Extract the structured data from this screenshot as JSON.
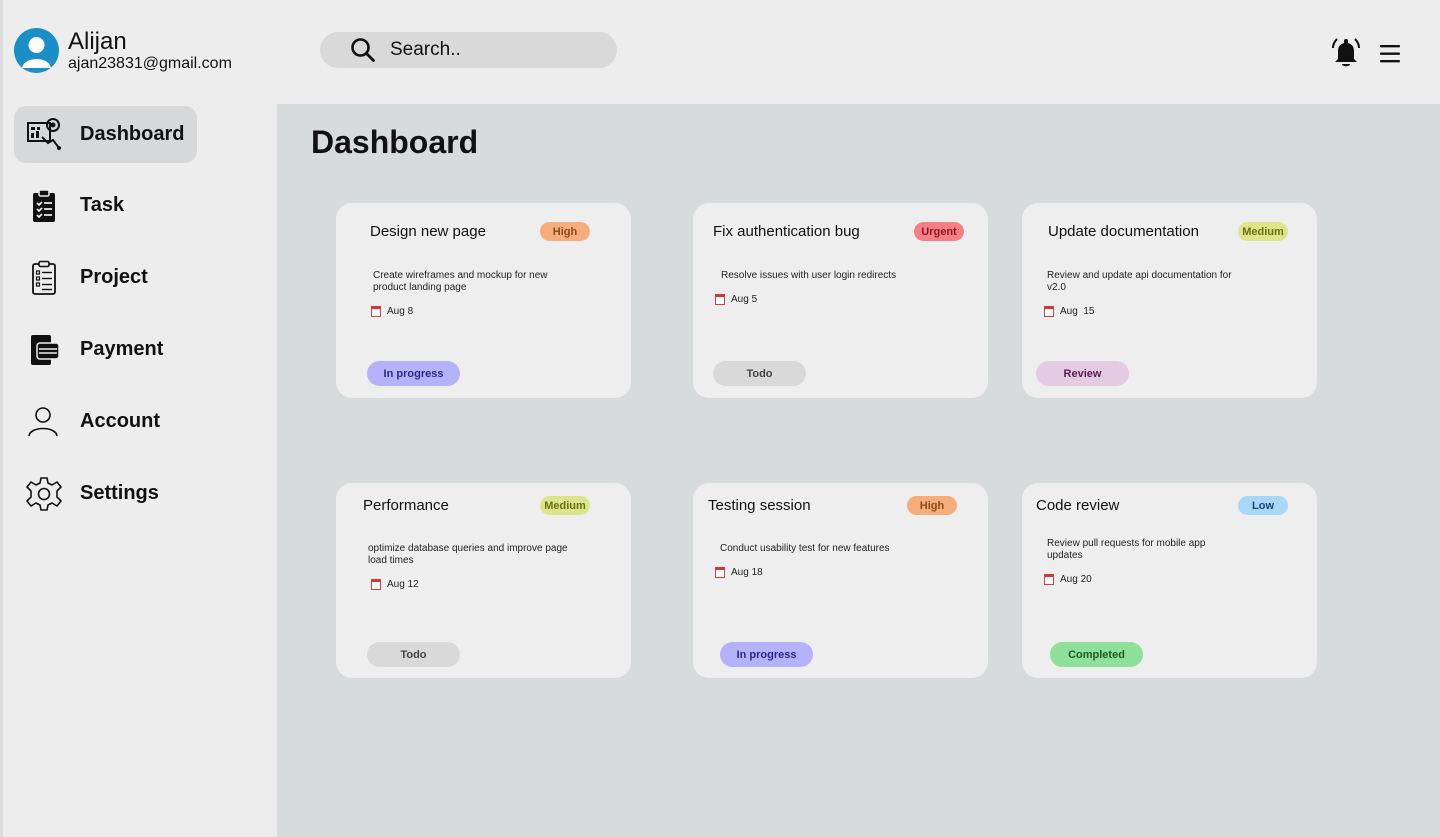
{
  "user": {
    "name": "Alijan",
    "email": "ajan23831@gmail.com"
  },
  "search": {
    "placeholder": "Search.."
  },
  "header": {
    "bell_icon": "bell-icon",
    "menu_icon": "hamburger-menu-icon"
  },
  "sidebar": {
    "items": [
      {
        "label": "Dashboard",
        "icon": "dashboard-icon",
        "active": true
      },
      {
        "label": "Task",
        "icon": "clipboard-icon"
      },
      {
        "label": "Project",
        "icon": "checklist-icon"
      },
      {
        "label": "Payment",
        "icon": "wallet-icon"
      },
      {
        "label": "Account",
        "icon": "user-icon"
      },
      {
        "label": "Settings",
        "icon": "gear-icon"
      }
    ]
  },
  "main": {
    "title": "Dashboard",
    "cards": [
      {
        "title": "Design new page",
        "priority": "High",
        "description": "Create wireframes and mockup for new product landing page",
        "date": "Aug 8",
        "status": "In progress"
      },
      {
        "title": "Fix authentication bug",
        "priority": "Urgent",
        "description": "Resolve issues with user login redirects",
        "date": "Aug 5",
        "status": "Todo"
      },
      {
        "title": "Update documentation",
        "priority": "Medium",
        "description": "Review and update api documentation for v2.0",
        "date": "Aug  15",
        "status": "Review"
      },
      {
        "title": "Performance",
        "priority": "Medium",
        "description": "optimize database queries and improve page load times",
        "date": "Aug 12",
        "status": "Todo"
      },
      {
        "title": "Testing session",
        "priority": "High",
        "description": "Conduct usability test for new features",
        "date": "Aug 18",
        "status": "In progress"
      },
      {
        "title": "Code review",
        "priority": "Low",
        "description": "Review pull requests for mobile app updates",
        "date": "Aug 20",
        "status": "Completed"
      }
    ]
  },
  "colors": {
    "High": "#f6ad7b",
    "Urgent": "#f47f84",
    "Medium": "#dde58a",
    "Low": "#a8d8f5",
    "In progress": "#b3b2fb",
    "Todo": "#d9d9d9",
    "Review": "#e3cbe1",
    "Completed": "#8fe09b"
  }
}
